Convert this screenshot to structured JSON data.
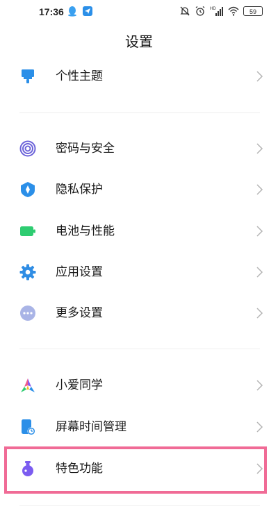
{
  "status_bar": {
    "time": "17:36",
    "battery": "59",
    "network": "HD"
  },
  "header": {
    "title": "设置"
  },
  "settings": {
    "items": [
      {
        "label": "个性主题",
        "icon": "paintbrush-icon"
      },
      {
        "label": "密码与安全",
        "icon": "fingerprint-icon"
      },
      {
        "label": "隐私保护",
        "icon": "privacy-shield-icon"
      },
      {
        "label": "电池与性能",
        "icon": "battery-icon"
      },
      {
        "label": "应用设置",
        "icon": "gear-icon"
      },
      {
        "label": "更多设置",
        "icon": "more-dots-icon"
      },
      {
        "label": "小爱同学",
        "icon": "xiaoai-icon"
      },
      {
        "label": "屏幕时间管理",
        "icon": "screen-time-icon"
      },
      {
        "label": "特色功能",
        "icon": "flask-icon"
      }
    ]
  },
  "colors": {
    "accent_blue": "#2b8fe8",
    "battery_green": "#2ecc71",
    "gear_blue": "#2f8de4",
    "more_gray_blue": "#a9b4e6",
    "fingerprint_purple": "#6c63d9",
    "flask_purple": "#7b5cf0",
    "highlight_pink": "#f06b96"
  }
}
